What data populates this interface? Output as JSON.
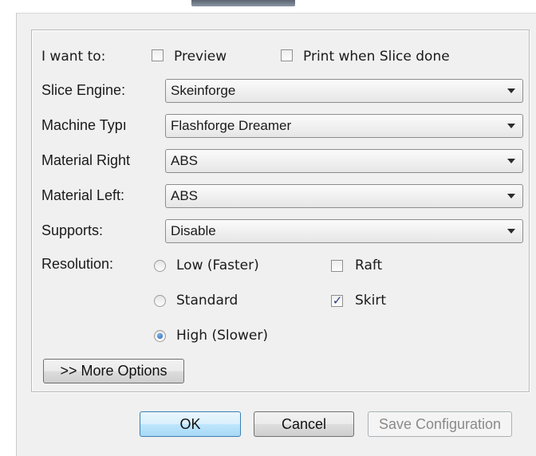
{
  "options": {
    "i_want_to_label": "I want to:",
    "preview_label": "Preview",
    "preview_checked": false,
    "print_label": "Print when Slice done",
    "print_checked": false
  },
  "fields": [
    {
      "label": "Slice Engine:",
      "value": "Skeinforge"
    },
    {
      "label": "Machine Typı",
      "value": "Flashforge Dreamer"
    },
    {
      "label": "Material Right",
      "value": "ABS"
    },
    {
      "label": "Material Left:",
      "value": "ABS"
    },
    {
      "label": "Supports:",
      "value": "Disable"
    }
  ],
  "resolution": {
    "label": "Resolution:",
    "options": [
      {
        "label": "Low (Faster)",
        "selected": false
      },
      {
        "label": "Standard",
        "selected": false
      },
      {
        "label": "High (Slower)",
        "selected": true
      }
    ],
    "selected": "High (Slower)"
  },
  "extras": {
    "raft_label": "Raft",
    "raft_checked": false,
    "skirt_label": "Skirt",
    "skirt_checked": true
  },
  "more_options_label": ">> More Options",
  "buttons": {
    "ok": "OK",
    "cancel": "Cancel",
    "save": "Save Configuration"
  },
  "icons": {
    "check": "✓"
  }
}
